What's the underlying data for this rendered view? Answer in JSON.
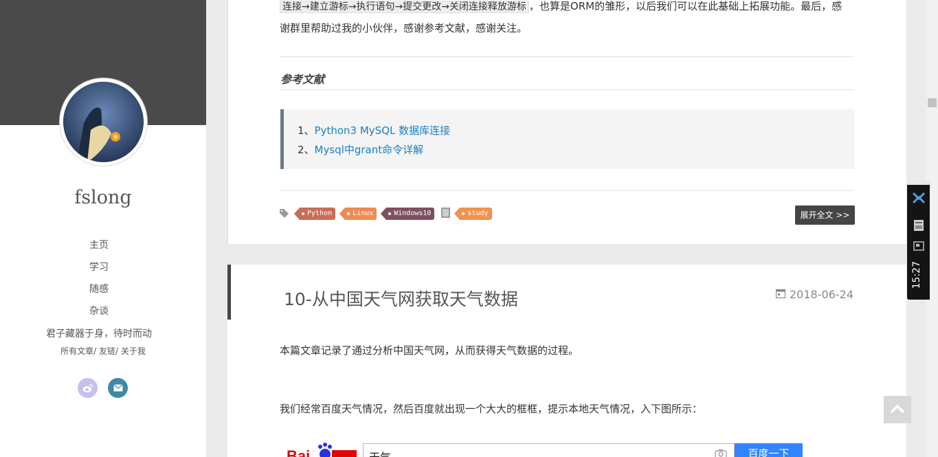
{
  "sidebar": {
    "site_name": "fslong",
    "nav": [
      "主页",
      "学习",
      "随感",
      "杂谈"
    ],
    "motto": "君子藏器于身，待时而动",
    "sublinks": [
      "所有文章",
      "友链",
      "关于我"
    ]
  },
  "post1": {
    "code_inline": "连接→建立游标→执行语句→提交更改→关闭连接释放游标",
    "text_after_code": "，也算是ORM的雏形，以后我们可以在此基础上拓展功能。最后，感",
    "text_line2": "谢群里帮助过我的小伙伴，感谢参考文献，感谢关注。",
    "ref_title": "参考文献",
    "refs": [
      {
        "prefix": "1、",
        "link": "Python3 MySQL 数据库连接"
      },
      {
        "prefix": "2、",
        "link": "Mysql中grant命令详解"
      }
    ],
    "tags": [
      "Python",
      "Linux",
      "Windows10",
      "study"
    ],
    "read_more": "展开全文 >>"
  },
  "post2": {
    "title": "10-从中国天气网获取天气数据",
    "date": "2018-06-24",
    "para1": "本篇文章记录了通过分析中国天气网，从而获得天气数据的过程。",
    "para2": "我们经常百度天气情况，然后百度就出现一个大大的框框，提示本地天气情况，入下图所示：",
    "search_value": "天气",
    "search_button": "百度一下"
  },
  "widget": {
    "clock": "15:27"
  },
  "colors": {
    "sidebar_cover": "#4a4a4a",
    "link": "#1a7fc4",
    "read_more_bg": "#454545"
  }
}
